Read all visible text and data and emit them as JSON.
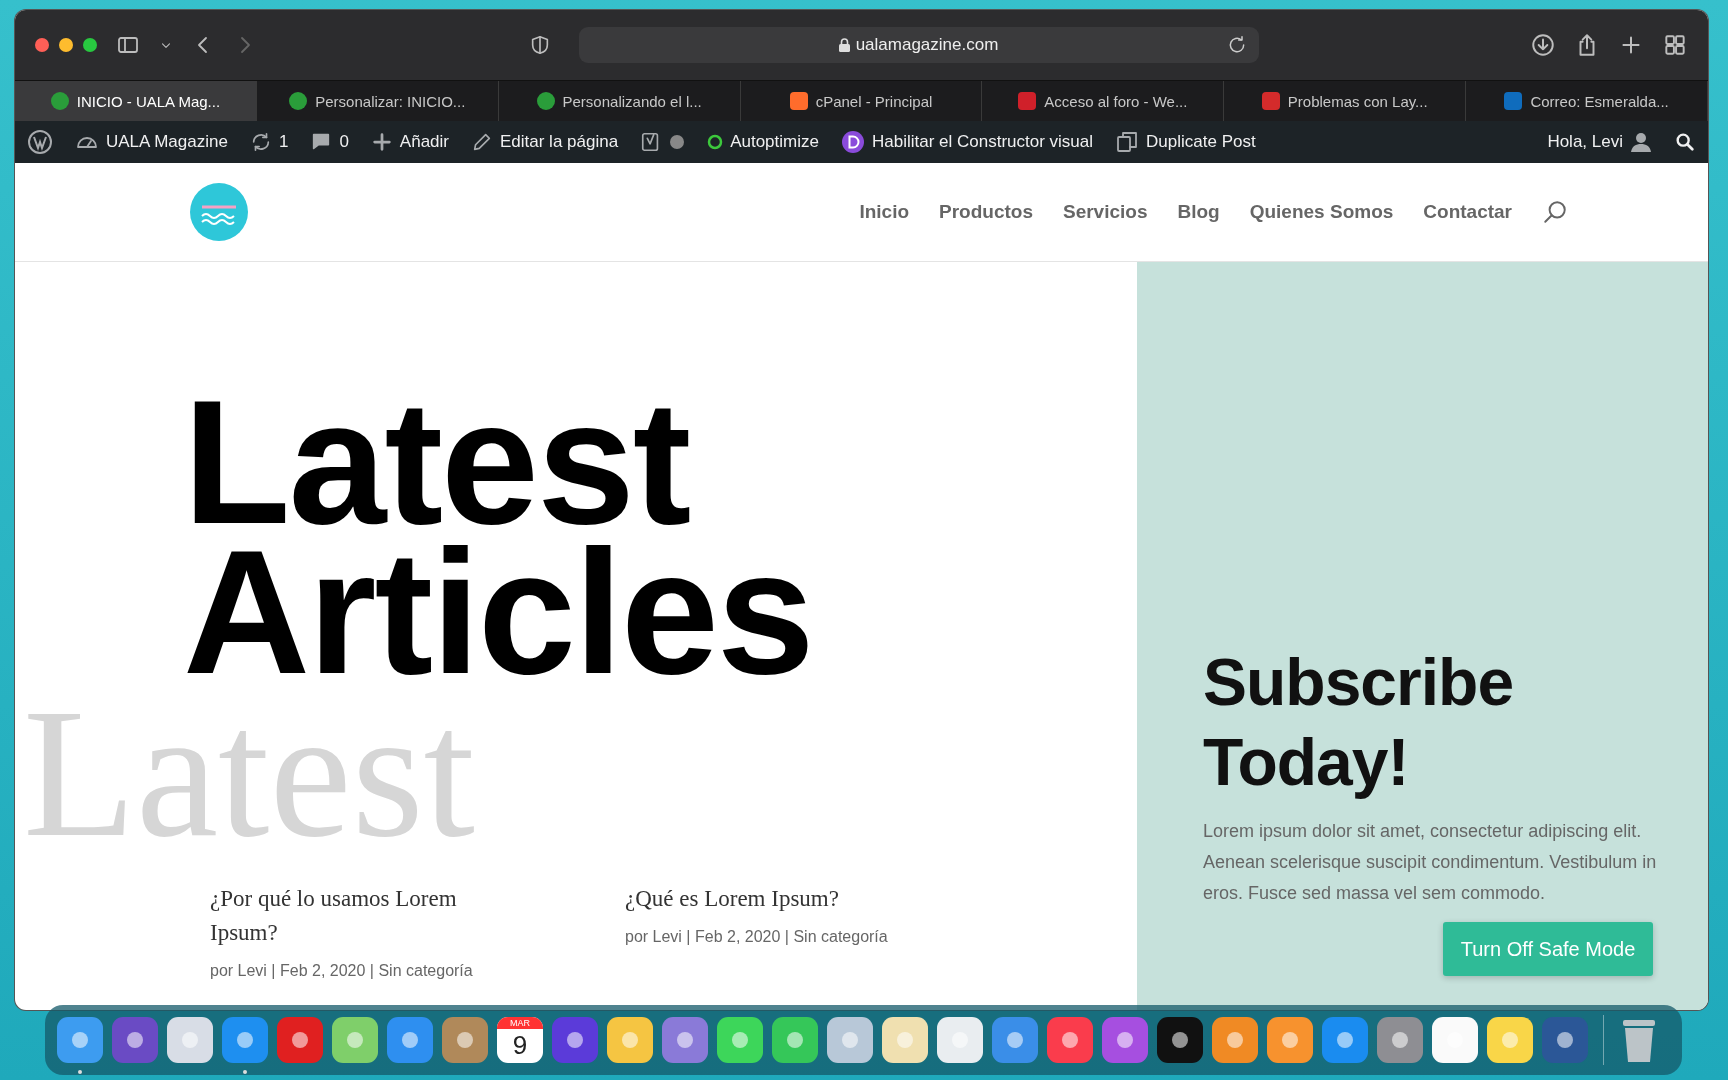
{
  "browser": {
    "url": "ualamagazine.com"
  },
  "tabs": [
    {
      "label": "INICIO - UALA Mag...",
      "selected": true,
      "color": "#2a9d3a"
    },
    {
      "label": "Personalizar: INICIO...",
      "selected": false,
      "color": "#2a9d3a"
    },
    {
      "label": "Personalizando el l...",
      "selected": false,
      "color": "#2a9d3a"
    },
    {
      "label": "cPanel - Principal",
      "selected": false,
      "color": "#ff6c2c"
    },
    {
      "label": "Acceso al foro - We...",
      "selected": false,
      "color": "#d0202a"
    },
    {
      "label": "Problemas con Lay...",
      "selected": false,
      "color": "#d42b2b"
    },
    {
      "label": "Correo: Esmeralda...",
      "selected": false,
      "color": "#0f6cbd"
    }
  ],
  "admin_bar": {
    "site": "UALA Magazine",
    "updates": "1",
    "comments": "0",
    "add": "Añadir",
    "edit": "Editar la página",
    "autoptimize": "Autoptimize",
    "builder": "Habilitar el Constructor visual",
    "duplicate": "Duplicate Post",
    "greeting": "Hola, Levi"
  },
  "nav": [
    "Inicio",
    "Productos",
    "Servicios",
    "Blog",
    "Quienes Somos",
    "Contactar"
  ],
  "hero": {
    "ghost": "Latest",
    "title_lines": [
      "Latest",
      "Articles"
    ]
  },
  "posts": [
    {
      "title": "¿Por qué lo usamos Lorem Ipsum?",
      "meta": "por Levi | Feb 2, 2020 | Sin categoría"
    },
    {
      "title": "¿Qué es Lorem Ipsum?",
      "meta": "por Levi | Feb 2, 2020 | Sin categoría"
    }
  ],
  "subscribe": {
    "title": "Subscribe Today!",
    "text": "Lorem ipsum dolor sit amet, consectetur adipiscing elit. Aenean scelerisque suscipit condimentum. Vestibulum in eros. Fusce sed massa vel sem commodo."
  },
  "safe_mode_button": "Turn Off Safe Mode",
  "dock": [
    {
      "color": "#3d9cf0",
      "running": true
    },
    {
      "color": "#6a4bc4",
      "running": false
    },
    {
      "color": "#d8dde6",
      "running": false
    },
    {
      "color": "#1e8ff0",
      "running": true
    },
    {
      "color": "#e02020",
      "running": false
    },
    {
      "color": "#7fcf6a",
      "running": false
    },
    {
      "color": "#2e8ff0",
      "running": false
    },
    {
      "color": "#b0895a",
      "running": false
    },
    {
      "kind": "calendar",
      "month": "MAR",
      "day": "9",
      "color": "#ffffff",
      "running": false
    },
    {
      "color": "#5b3bd9",
      "running": false
    },
    {
      "color": "#f5c542",
      "running": false
    },
    {
      "color": "#8a7ad8",
      "running": false
    },
    {
      "color": "#3dd65a",
      "running": false
    },
    {
      "color": "#35c759",
      "running": false
    },
    {
      "color": "#b8c8d8",
      "running": false
    },
    {
      "color": "#f0e0b0",
      "running": false
    },
    {
      "color": "#e9edf0",
      "running": false
    },
    {
      "color": "#3a8ee8",
      "running": false
    },
    {
      "color": "#fa3c4c",
      "running": false
    },
    {
      "color": "#a64fe0",
      "running": false
    },
    {
      "color": "#111111",
      "running": false
    },
    {
      "color": "#f08a24",
      "running": false
    },
    {
      "color": "#f7922e",
      "running": false
    },
    {
      "color": "#1a8cf0",
      "running": false
    },
    {
      "color": "#8e8e93",
      "running": false
    },
    {
      "color": "#fafafa",
      "running": false
    },
    {
      "color": "#f9d648",
      "running": false
    },
    {
      "color": "#2b5797",
      "running": false
    },
    {
      "kind": "trash",
      "color": "#bcc4c8"
    }
  ]
}
